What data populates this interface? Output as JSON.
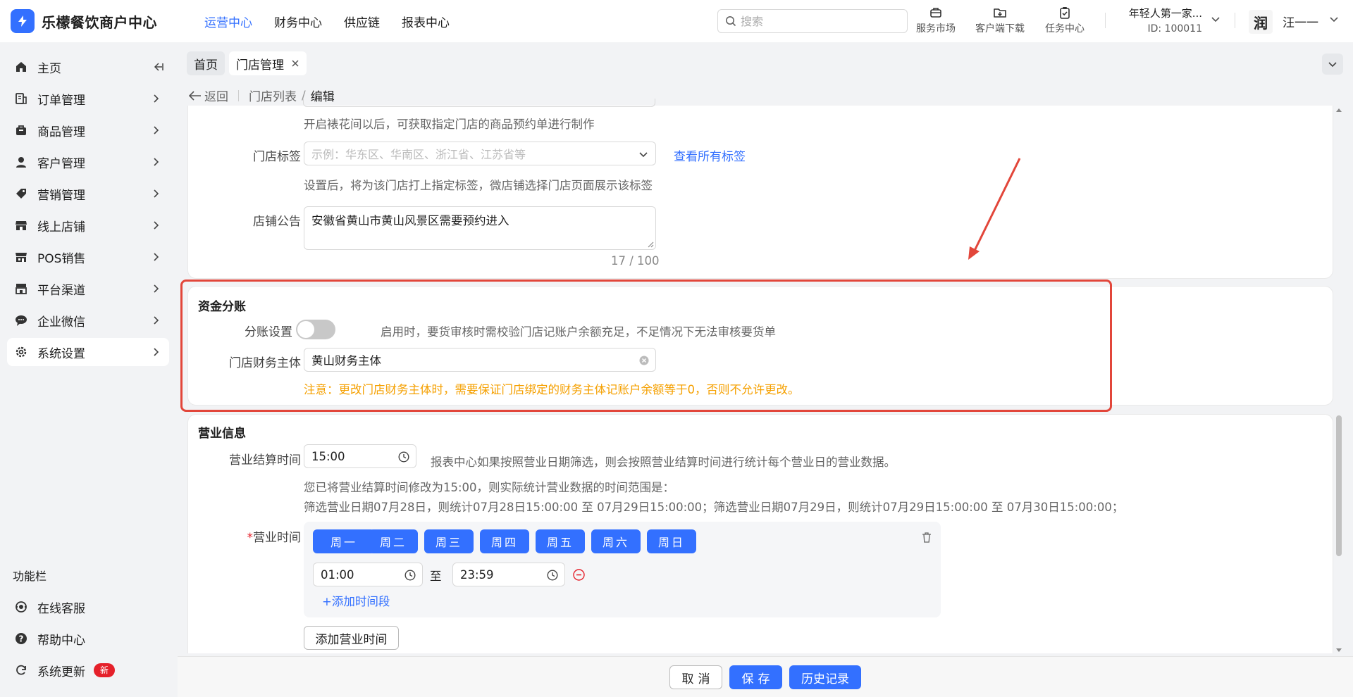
{
  "app": {
    "name": "乐檬餐饮商户中心"
  },
  "topnav": [
    {
      "label": "运营中心",
      "active": true
    },
    {
      "label": "财务中心"
    },
    {
      "label": "供应链"
    },
    {
      "label": "报表中心"
    }
  ],
  "search": {
    "placeholder": "搜索"
  },
  "tools": {
    "market": "服务市场",
    "download": "客户端下载",
    "tasks": "任务中心"
  },
  "account": {
    "name": "年轻人第一家...",
    "id": "ID: 100011"
  },
  "user": {
    "avatar": "润",
    "name": "汪一一"
  },
  "sidebar": {
    "items": [
      {
        "label": "主页",
        "icon": "home-icon"
      },
      {
        "label": "订单管理",
        "icon": "order-icon"
      },
      {
        "label": "商品管理",
        "icon": "bag-icon"
      },
      {
        "label": "客户管理",
        "icon": "user-icon"
      },
      {
        "label": "营销管理",
        "icon": "tag-icon"
      },
      {
        "label": "线上店铺",
        "icon": "store-icon"
      },
      {
        "label": "POS销售",
        "icon": "pos-icon"
      },
      {
        "label": "平台渠道",
        "icon": "channel-icon"
      },
      {
        "label": "企业微信",
        "icon": "chat-icon"
      },
      {
        "label": "系统设置",
        "icon": "gear-icon",
        "active": true
      }
    ],
    "func_title": "功能栏",
    "func_items": [
      {
        "label": "在线客服",
        "icon": "service-icon"
      },
      {
        "label": "帮助中心",
        "icon": "help-icon"
      },
      {
        "label": "系统更新",
        "icon": "refresh-icon",
        "badge": "新"
      }
    ]
  },
  "tabs": {
    "home": "首页",
    "current": "门店管理"
  },
  "breadcrumb": {
    "back": "返回",
    "list": "门店列表",
    "slash": "/",
    "current": "编辑"
  },
  "store_form": {
    "top_hint": "开启裱花间以后，可获取指定门店的商品预约单进行制作",
    "tag_label": "门店标签",
    "tag_placeholder": "示例：华东区、华南区、浙江省、江苏省等",
    "tag_link": "查看所有标签",
    "tag_hint": "设置后，将为该门店打上指定标签，微店铺选择门店页面展示该标签",
    "notice_label": "店铺公告",
    "notice_value": "安徽省黄山市黄山风景区需要预约进入",
    "notice_count": "17 / 100"
  },
  "funds": {
    "title": "资金分账",
    "split_label": "分账设置",
    "split_enabled": false,
    "split_hint": "启用时，要货审核时需校验门店记账户余额充足，不足情况下无法审核要货单",
    "entity_label": "门店财务主体",
    "entity_value": "黄山财务主体",
    "warning": "注意：更改门店财务主体时，需要保证门店绑定的财务主体记账户余额等于0，否则不允许更改。"
  },
  "business": {
    "title": "营业信息",
    "settle_label": "营业结算时间",
    "settle_value": "15:00",
    "settle_hint": "报表中心如果按照营业日期筛选，则会按照营业结算时间进行统计每个营业日的营业数据。",
    "range_line1": "您已将营业结算时间修改为15:00，则实际统计营业数据的时间范围是：",
    "range_line2": "筛选营业日期07月28日，则统计07月28日15:00:00 至 07月29日15:00:00；筛选营业日期07月29日，则统计07月29日15:00:00 至 07月30日15:00:00；",
    "hours_required_mark": "*",
    "hours_label": "营业时间",
    "days": [
      "周一",
      "周二",
      "周三",
      "周四",
      "周五",
      "周六",
      "周日"
    ],
    "start_time": "01:00",
    "to": "至",
    "end_time": "23:59",
    "add_period": "+添加时间段",
    "add_hours": "添加营业时间"
  },
  "footer": {
    "cancel": "取消",
    "save": "保存",
    "history": "历史记录"
  },
  "colors": {
    "primary": "#3370ff",
    "warning": "#f5a000",
    "highlight": "#e2463a",
    "badge": "#e5202a"
  }
}
